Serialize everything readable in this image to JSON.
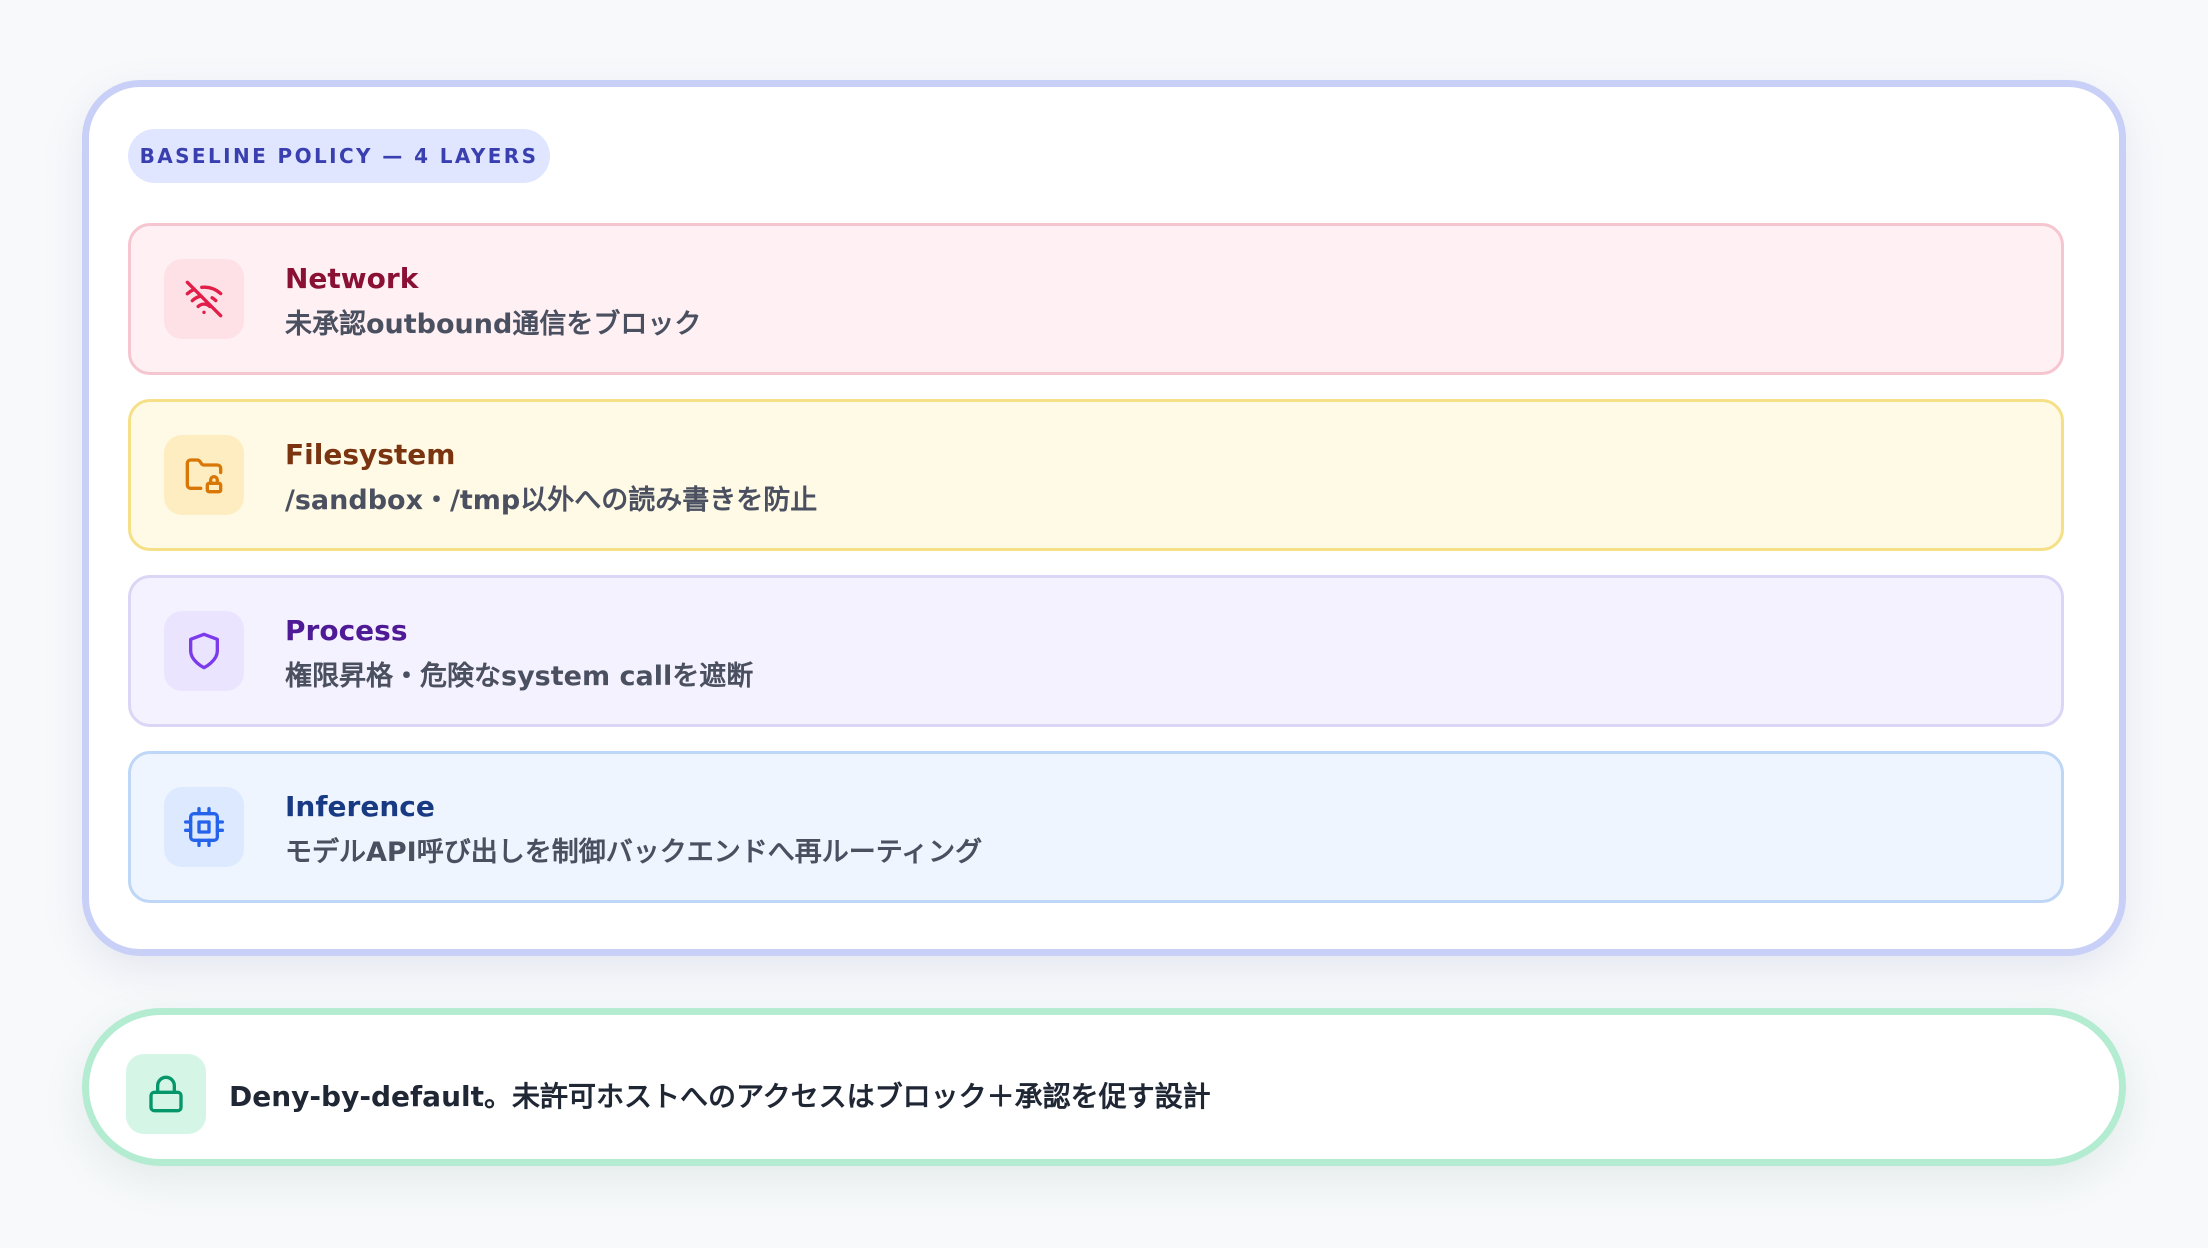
{
  "policy": {
    "badge": "BASELINE POLICY — 4 LAYERS",
    "layers": [
      {
        "title": "Network",
        "description": "未承認outbound通信をブロック",
        "icon": "wifi-off-icon",
        "accent": "#e11d48"
      },
      {
        "title": "Filesystem",
        "description": "/sandbox・/tmp以外への読み書きを防止",
        "icon": "folder-lock-icon",
        "accent": "#d97706"
      },
      {
        "title": "Process",
        "description": "権限昇格・危険なsystem callを遮断",
        "icon": "shield-icon",
        "accent": "#7c3aed"
      },
      {
        "title": "Inference",
        "description": "モデルAPI呼び出しを制御バックエンドへ再ルーティング",
        "icon": "cpu-icon",
        "accent": "#2563eb"
      }
    ]
  },
  "callout": {
    "icon": "lock-icon",
    "accent": "#059669",
    "text": "Deny-by-default。未許可ホストへのアクセスはブロック＋承認を促す設計"
  }
}
